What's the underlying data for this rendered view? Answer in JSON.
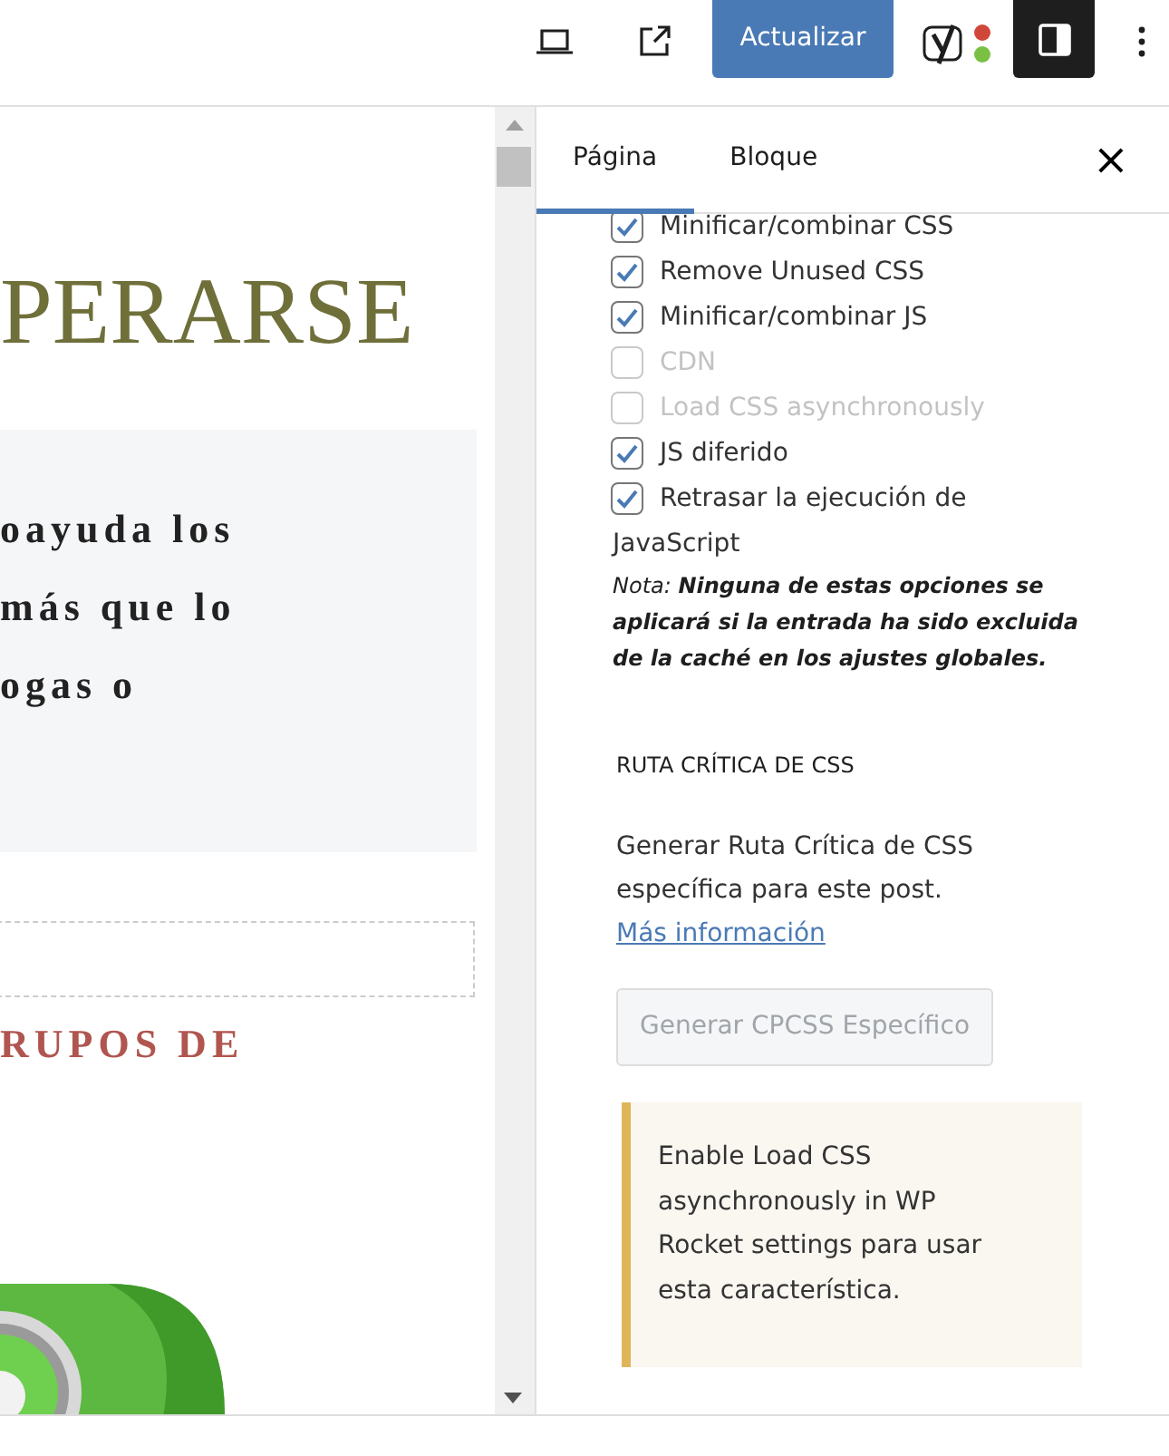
{
  "toolbar": {
    "update_button": "Actualizar",
    "sidebar_toggle": {
      "on": true
    }
  },
  "editor": {
    "heading": "PERARSE",
    "quote_lines": [
      "oayuda los",
      "más que lo",
      "ogas o"
    ],
    "subheading": "RUPOS DE"
  },
  "sidebar": {
    "tabs": [
      {
        "label": "Página",
        "selected": true
      },
      {
        "label": "Bloque",
        "selected": false
      }
    ],
    "close": "×",
    "options": [
      {
        "label": "Minificar/combinar CSS",
        "checked": true,
        "disabled": false
      },
      {
        "label": "Remove Unused CSS",
        "checked": true,
        "disabled": false
      },
      {
        "label": "Minificar/combinar JS",
        "checked": true,
        "disabled": false
      },
      {
        "label": "CDN",
        "checked": false,
        "disabled": true
      },
      {
        "label": "Load CSS asynchronously",
        "checked": false,
        "disabled": true
      },
      {
        "label": "JS diferido",
        "checked": true,
        "disabled": false
      },
      {
        "label": "Retrasar la ejecución de JavaScript",
        "checked": true,
        "disabled": false
      }
    ],
    "note": "Nota: **Ninguna de estas opciones se aplicará si la entrada ha sido excluida de la caché en los ajustes globales.**",
    "section_title": "RUTA CRÍTICA DE CSS",
    "description": "Generar Ruta Crítica de CSS específica para este post.",
    "more_link": "Más información",
    "generate_button": {
      "label": "Generar CPCSS Específico",
      "disabled": true
    },
    "notice": "Enable Load CSS asynchronously in WP Rocket settings para usar esta característica."
  }
}
